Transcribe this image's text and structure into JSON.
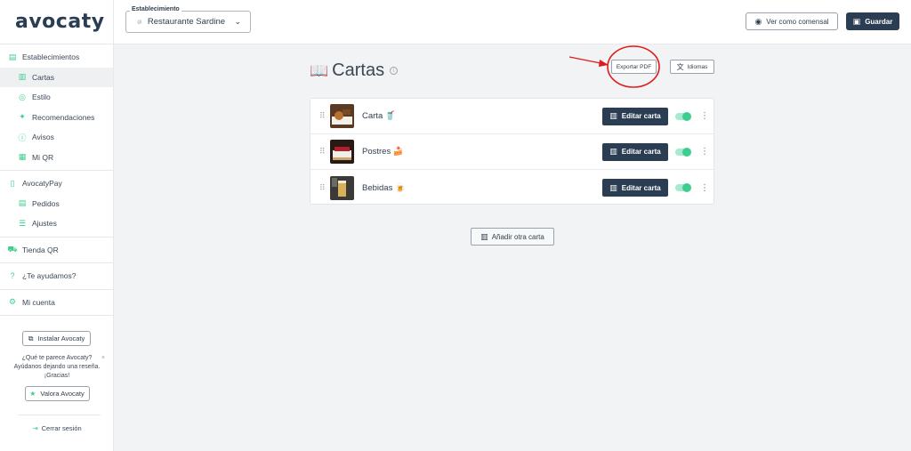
{
  "brand": {
    "logo_text": "avocaty",
    "accent": "#3ecf8e",
    "dark": "#2a3d52"
  },
  "sidebar": {
    "sections": [
      {
        "items": [
          {
            "label": "Establecimientos",
            "icon": "store-icon"
          },
          {
            "label": "Cartas",
            "icon": "menu-book-icon",
            "active": true
          },
          {
            "label": "Estilo",
            "icon": "palette-icon"
          },
          {
            "label": "Recomendaciones",
            "icon": "sparkle-icon"
          },
          {
            "label": "Avisos",
            "icon": "broadcast-icon"
          },
          {
            "label": "Mi QR",
            "icon": "qr-icon"
          }
        ]
      },
      {
        "items": [
          {
            "label": "AvocatyPay",
            "icon": "payment-icon"
          },
          {
            "label": "Pedidos",
            "icon": "orders-icon"
          },
          {
            "label": "Ajustes",
            "icon": "settings-icon"
          }
        ]
      },
      {
        "items": [
          {
            "label": "Tienda QR",
            "icon": "cart-icon"
          }
        ]
      },
      {
        "items": [
          {
            "label": "¿Te ayudamos?",
            "icon": "help-icon"
          }
        ]
      },
      {
        "items": [
          {
            "label": "Mi cuenta",
            "icon": "gear-icon"
          }
        ]
      }
    ],
    "install_label": "Instalar Avocaty",
    "rate_text_1": "¿Qué te parece Avocaty?",
    "rate_text_2": "Ayúdanos dejando una reseña.",
    "rate_text_3": "¡Gracias!",
    "rate_button": "Valora Avocaty",
    "logout": "Cerrar sesión"
  },
  "topbar": {
    "establishment_legend": "Establecimiento",
    "establishment_value": "Restaurante Sardine",
    "view_as_label": "Ver como comensal",
    "save_label": "Guardar"
  },
  "main": {
    "title": "Cartas",
    "export_pdf": "Exportar PDF",
    "languages": "Idiomas",
    "menus": [
      {
        "name": "Carta 🥤",
        "edit": "Editar carta",
        "enabled": true
      },
      {
        "name": "Postres 🍰",
        "edit": "Editar carta",
        "enabled": true
      },
      {
        "name": "Bebidas 🍺",
        "edit": "Editar carta",
        "enabled": true
      }
    ],
    "add_menu": "Añadir otra carta"
  }
}
